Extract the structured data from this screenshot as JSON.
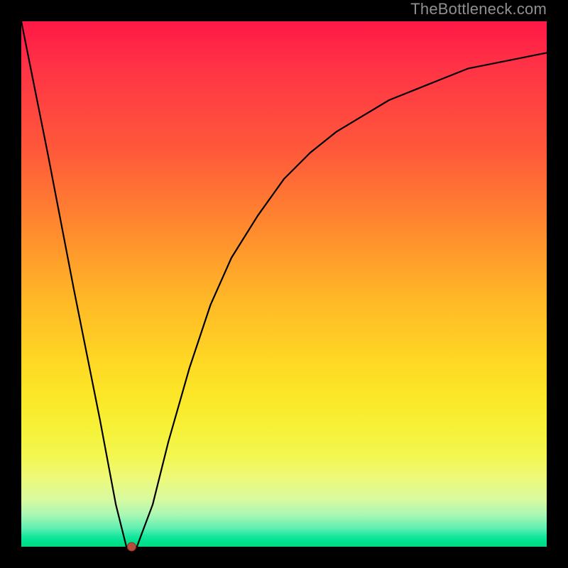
{
  "watermark": "TheBottleneck.com",
  "chart_data": {
    "type": "line",
    "title": "",
    "xlabel": "",
    "ylabel": "",
    "xlim": [
      0,
      100
    ],
    "ylim": [
      0,
      100
    ],
    "grid": false,
    "legend": false,
    "series": [
      {
        "name": "bottleneck-curve",
        "x": [
          0,
          5,
          10,
          15,
          18,
          20,
          22,
          25,
          28,
          32,
          36,
          40,
          45,
          50,
          55,
          60,
          65,
          70,
          75,
          80,
          85,
          90,
          95,
          100
        ],
        "values": [
          100,
          75,
          49,
          24,
          8,
          0,
          0,
          8,
          20,
          34,
          46,
          55,
          63,
          70,
          75,
          79,
          82,
          85,
          87,
          89,
          91,
          92,
          93,
          94
        ]
      }
    ],
    "marker": {
      "x": 21,
      "y": 0
    },
    "background_gradient": {
      "top": "#ff1846",
      "upper_mid": "#ff8c2e",
      "mid": "#ffe028",
      "lower_mid": "#f3f752",
      "bottom": "#00db7e"
    },
    "axes_visible": false,
    "frame_color": "#000000"
  }
}
